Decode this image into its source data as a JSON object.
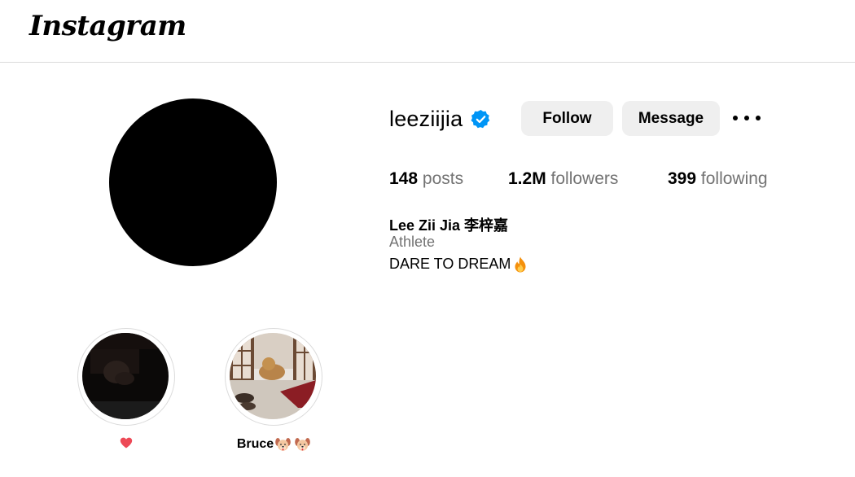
{
  "header": {
    "logo_text": "Instagram"
  },
  "profile": {
    "username": "leeziijia",
    "verified_icon": "verified-badge-icon",
    "follow_label": "Follow",
    "message_label": "Message",
    "more_icon": "more-options-icon",
    "stats": {
      "posts_count": "148",
      "posts_label": "posts",
      "followers_count": "1.2M",
      "followers_label": "followers",
      "following_count": "399",
      "following_label": "following"
    },
    "bio": {
      "name": "Lee Zii Jia 李梓嘉",
      "category": "Athlete",
      "text": "DARE TO DREAM",
      "emoji_icon": "fire-emoji-icon"
    }
  },
  "highlights": [
    {
      "label": "",
      "emoji_icon": "heart-emoji-icon"
    },
    {
      "label": "Bruce",
      "emoji_icon": "dog-face-emoji-icon"
    }
  ],
  "colors": {
    "accent_verified": "#0095f6",
    "button_bg": "#efefef",
    "secondary_text": "#737373",
    "divider": "#dbdbdb",
    "heart": "#ed4956"
  }
}
